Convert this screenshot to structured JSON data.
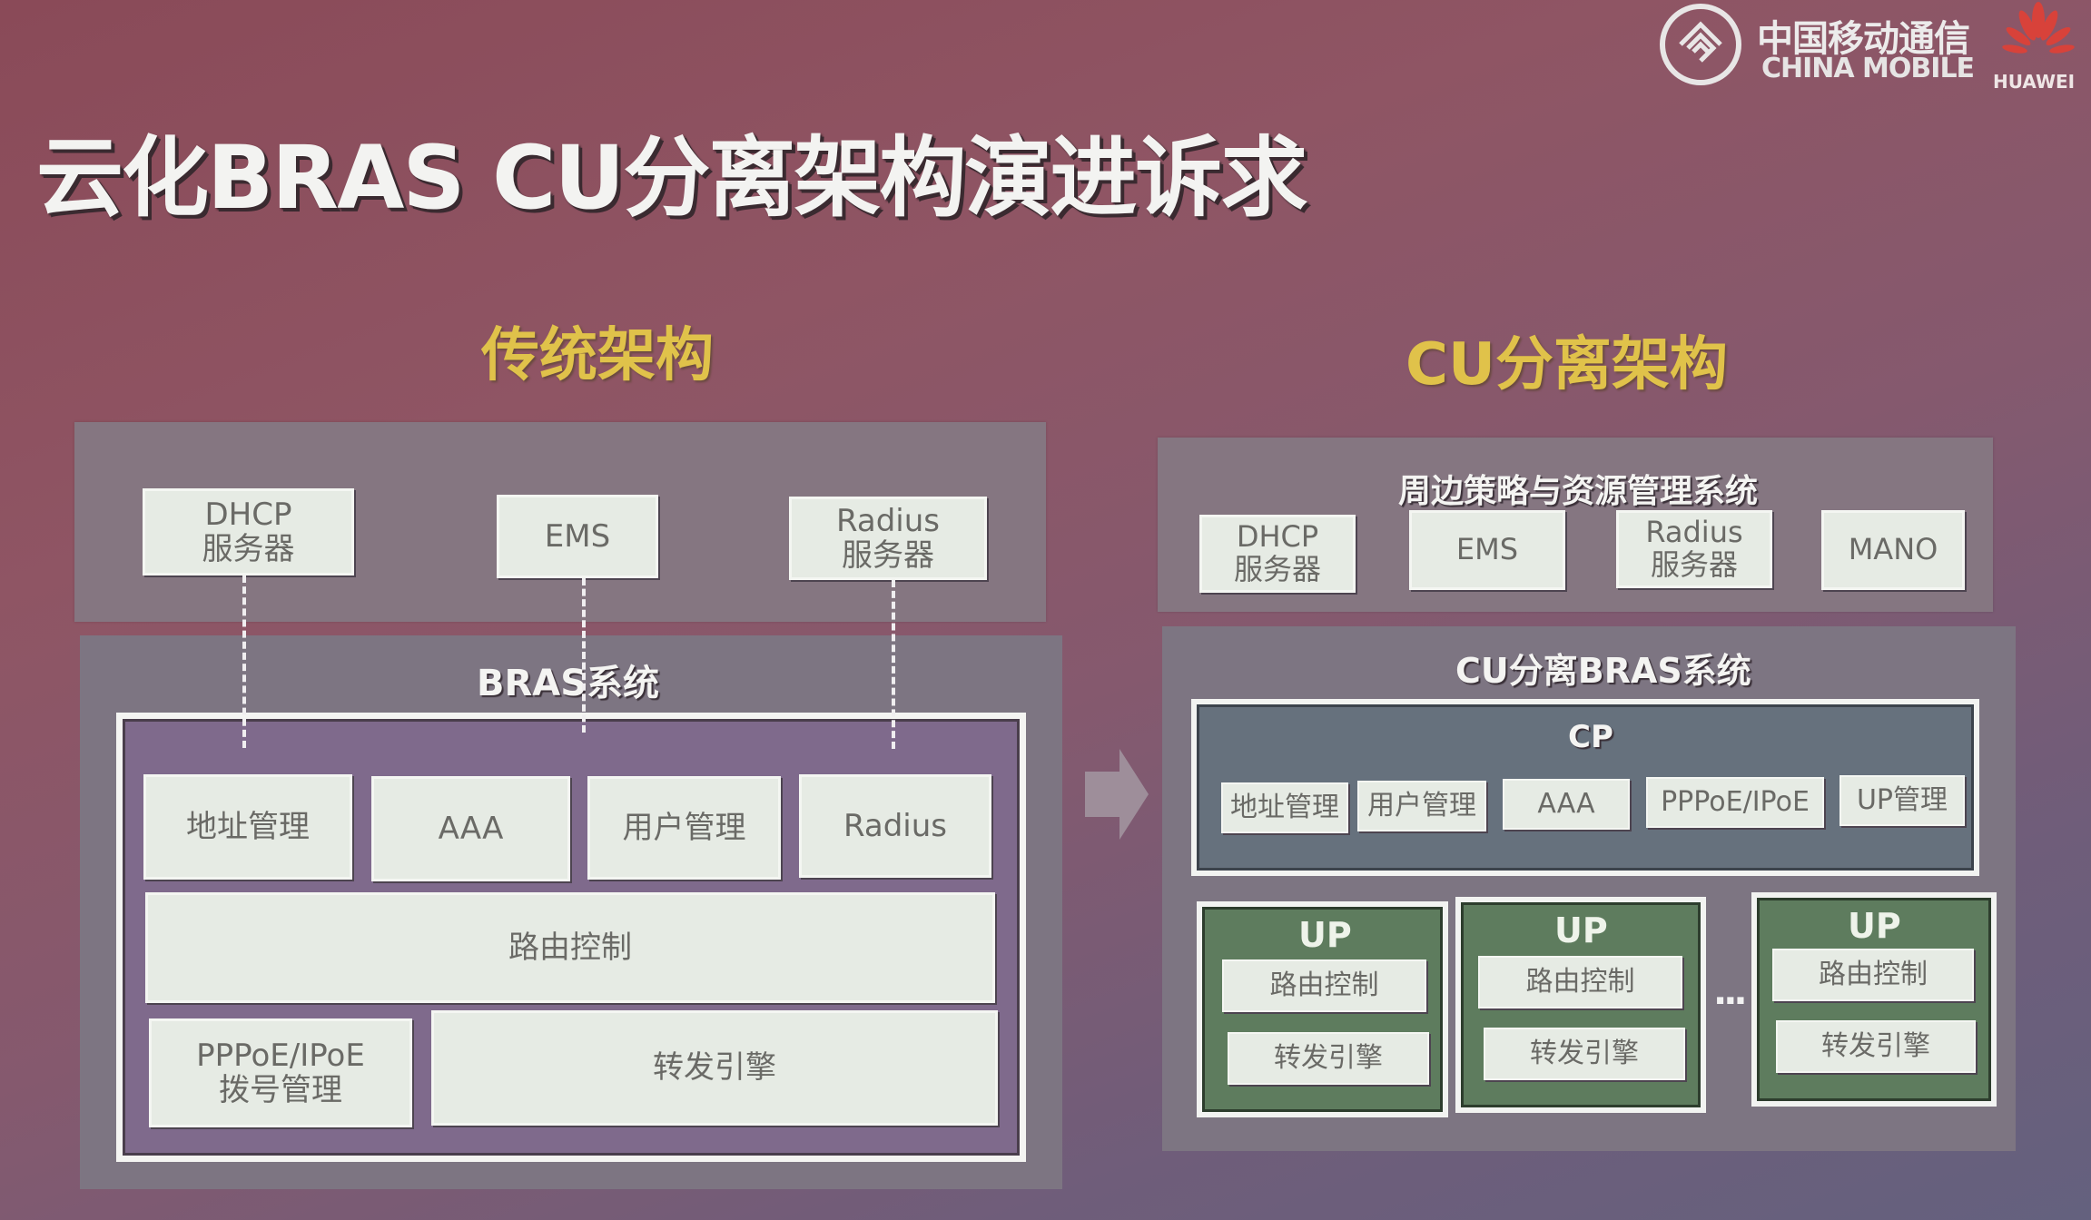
{
  "slide": {
    "title": "云化BRAS CU分离架构演进诉求"
  },
  "logos": {
    "china_mobile_cn": "中国移动通信",
    "china_mobile_en": "CHINA MOBILE",
    "huawei": "HUAWEI"
  },
  "colors": {
    "section_title": "#e0c24a",
    "node_fill": "#e6ebe4",
    "bras_inner": "#7f6a8c",
    "cp_fill": "#66717d",
    "up_fill": "#5e7c5e",
    "panel": "#857681"
  },
  "traditional": {
    "heading": "传统架构",
    "external_systems": [
      {
        "line1": "DHCP",
        "line2": "服务器"
      },
      {
        "line1": "EMS",
        "line2": ""
      },
      {
        "line1": "Radius",
        "line2": "服务器"
      }
    ],
    "bras_label": "BRAS系统",
    "row1": [
      "地址管理",
      "AAA",
      "用户管理",
      "Radius"
    ],
    "routing": "路由控制",
    "dial": {
      "line1": "PPPoE/IPoE",
      "line2": "拨号管理"
    },
    "forwarding": "转发引擎"
  },
  "arrow": {
    "icon": "right-arrow-icon"
  },
  "cu": {
    "heading": "CU分离架构",
    "peripheral_label": "周边策略与资源管理系统",
    "external_systems": [
      {
        "line1": "DHCP",
        "line2": "服务器"
      },
      {
        "line1": "EMS",
        "line2": ""
      },
      {
        "line1": "Radius",
        "line2": "服务器"
      },
      {
        "line1": "MANO",
        "line2": ""
      }
    ],
    "system_label": "CU分离BRAS系统",
    "cp": {
      "label": "CP",
      "modules": [
        "地址管理",
        "用户管理",
        "AAA",
        "PPPoE/IPoE",
        "UP管理"
      ]
    },
    "ups": [
      {
        "label": "UP",
        "routing": "路由控制",
        "forwarding": "转发引擎"
      },
      {
        "label": "UP",
        "routing": "路由控制",
        "forwarding": "转发引擎"
      },
      {
        "label": "UP",
        "routing": "路由控制",
        "forwarding": "转发引擎"
      }
    ],
    "ellipsis": "..."
  }
}
